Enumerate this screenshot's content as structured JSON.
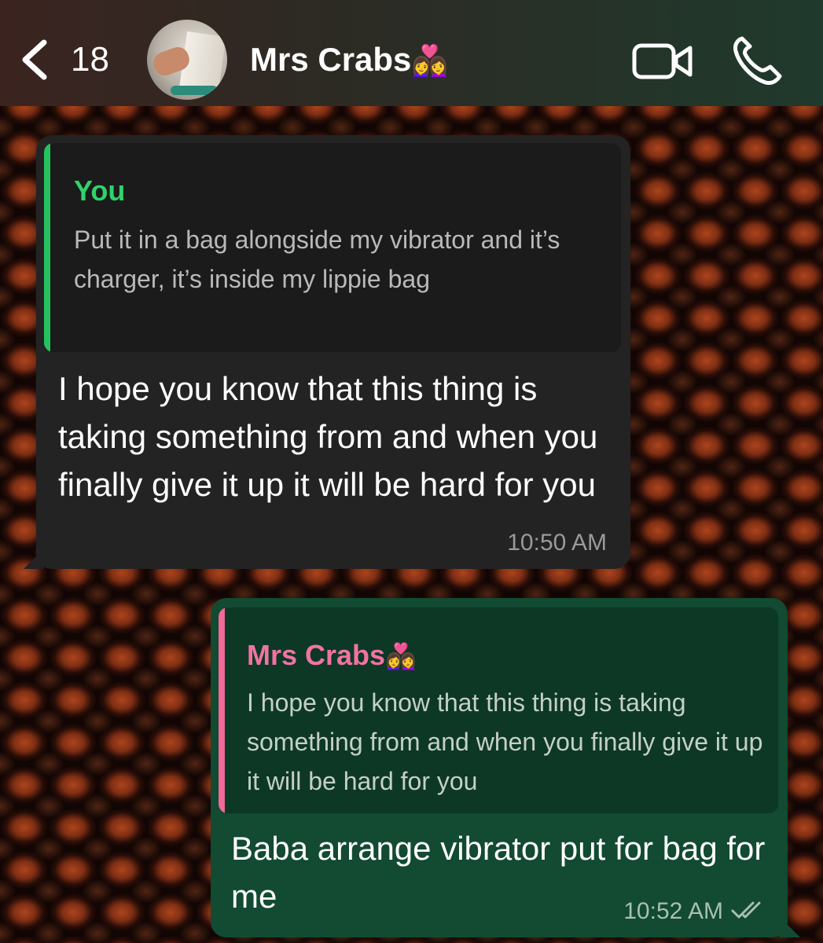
{
  "header": {
    "back_count": "18",
    "contact_name": "Mrs Crabs",
    "contact_emoji": "👩‍❤️‍👩",
    "icons": [
      "back-chevron-icon",
      "video-call-icon",
      "phone-call-icon"
    ]
  },
  "messages": [
    {
      "direction": "incoming",
      "reply_to": {
        "author": "You",
        "text": "Put it in a bag alongside my vibrator and it’s charger, it’s inside my lippie bag"
      },
      "text": "I hope you know that this thing is taking something from and when you finally give it up it will be hard for you",
      "time": "10:50 AM"
    },
    {
      "direction": "outgoing",
      "reply_to": {
        "author": "Mrs Crabs",
        "author_emoji": "👩‍❤️‍👩",
        "text": "I hope you know that this thing is taking something from and when you finally give it up it will be hard for you"
      },
      "text": "Baba arrange vibrator put for bag for me",
      "time": "10:52 AM",
      "status": "read-double-check-icon"
    }
  ],
  "colors": {
    "incoming_bubble": "#232323",
    "outgoing_bubble": "#124a32",
    "you_accent": "#2fd36a",
    "contact_accent": "#f173a1"
  }
}
